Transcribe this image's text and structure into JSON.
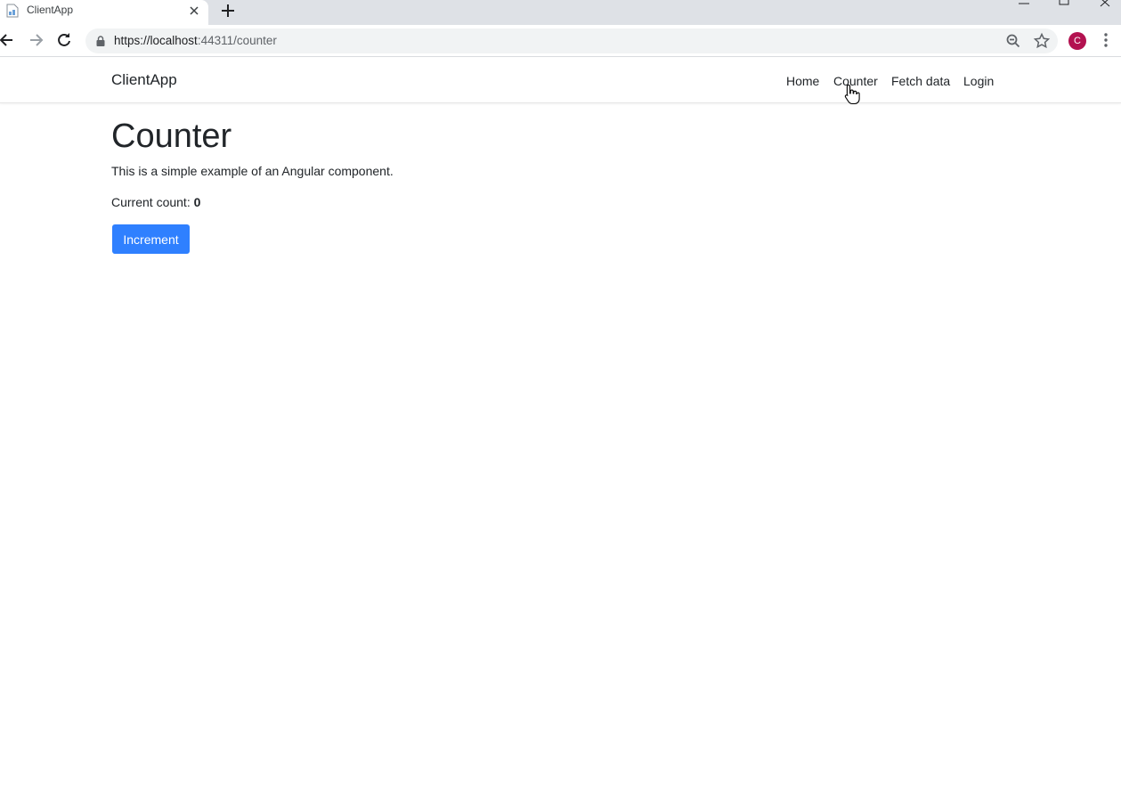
{
  "browser": {
    "tab_title": "ClientApp",
    "url_host": "https://localhost",
    "url_rest": ":44311/counter",
    "profile_initial": "C",
    "profile_color": "#b31250"
  },
  "app": {
    "brand": "ClientApp",
    "nav": {
      "home": "Home",
      "counter": "Counter",
      "fetch_data": "Fetch data",
      "login": "Login"
    }
  },
  "content": {
    "title": "Counter",
    "description": "This is a simple example of an Angular component.",
    "count_label": "Current count:",
    "count_value": "0",
    "increment_label": "Increment"
  },
  "colors": {
    "accent": "#2f80ff"
  }
}
